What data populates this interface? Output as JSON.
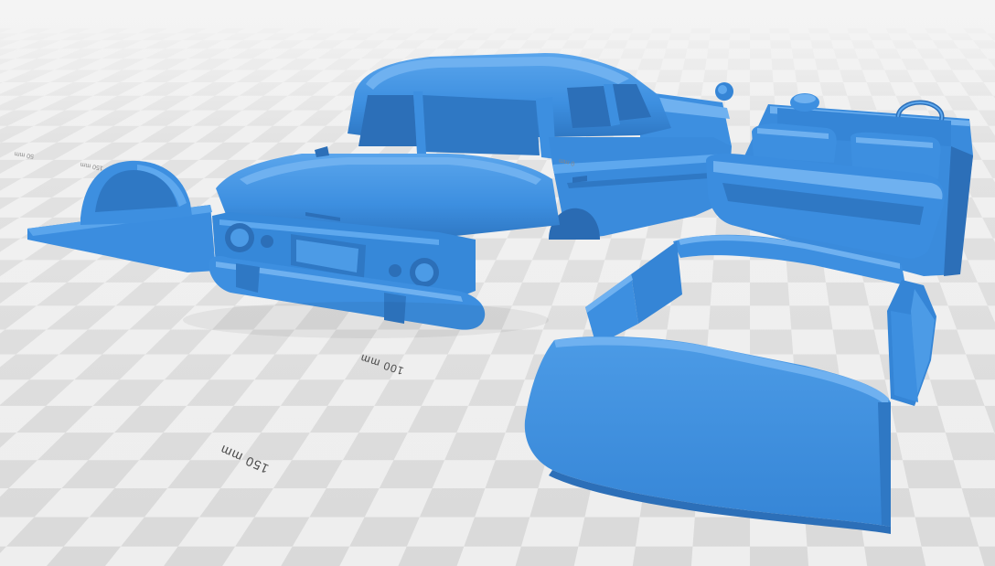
{
  "viewer": {
    "background_color": "#e9e9e9",
    "checker_light": "#eeeeee",
    "checker_dark": "#d9d9d9",
    "model_color": "#3d8fe0",
    "model_shadow": "#2c6fb8",
    "model_highlight": "#6fb1f0"
  },
  "rulers": {
    "label_100": "100 mm",
    "label_150": "150 mm",
    "label_far_1": "50 mm",
    "label_far_2": "150 mm",
    "label_far_3": "0 mm"
  },
  "parts": {
    "body": "car-body",
    "floor": "car-floor-pan",
    "interior": "car-interior",
    "glass": "car-window-glass"
  }
}
